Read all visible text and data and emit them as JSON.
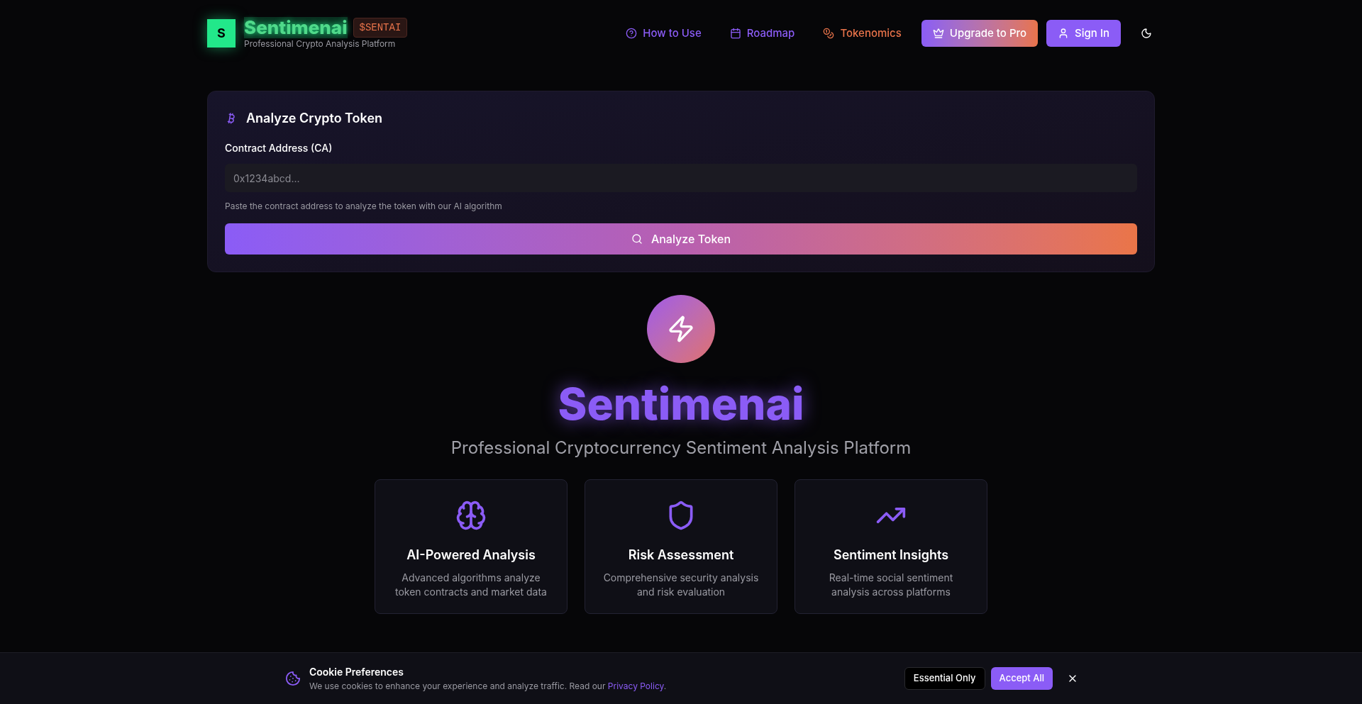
{
  "brand": {
    "logo_letter": "S",
    "name": "Sentimenai",
    "ticker": "$SENTAI",
    "tagline": "Professional Crypto Analysis Platform"
  },
  "nav": {
    "links": [
      {
        "label": "How to Use",
        "color": "#8b5cf6"
      },
      {
        "label": "Roadmap",
        "color": "#8b5cf6"
      },
      {
        "label": "Tokenomics",
        "color": "#e8734a"
      }
    ],
    "buttons": [
      {
        "label": "Upgrade to Pro",
        "kind": "gradient"
      },
      {
        "label": "Sign In",
        "kind": "solid"
      }
    ]
  },
  "analyze": {
    "title": "Analyze Crypto Token",
    "field_label": "Contract Address (CA)",
    "placeholder": "0x1234abcd...",
    "hint": "Paste the contract address to analyze the token with our AI algorithm",
    "button": "Analyze Token"
  },
  "hero": {
    "title": "Sentimenai",
    "subtitle": "Professional Cryptocurrency Sentiment Analysis Platform"
  },
  "features": [
    {
      "title": "AI-Powered Analysis",
      "text": "Advanced algorithms analyze token contracts and market data"
    },
    {
      "title": "Risk Assessment",
      "text": "Comprehensive security analysis and risk evaluation"
    },
    {
      "title": "Sentiment Insights",
      "text": "Real-time social sentiment analysis across platforms"
    }
  ],
  "cookie": {
    "title": "Cookie Preferences",
    "text": "We use cookies to enhance your experience and analyze traffic. Read our ",
    "link": "Privacy Policy",
    "text_end": ".",
    "buttons": [
      {
        "label": "Essential Only",
        "kind": "outline"
      },
      {
        "label": "Accept All",
        "kind": "solid"
      }
    ]
  }
}
